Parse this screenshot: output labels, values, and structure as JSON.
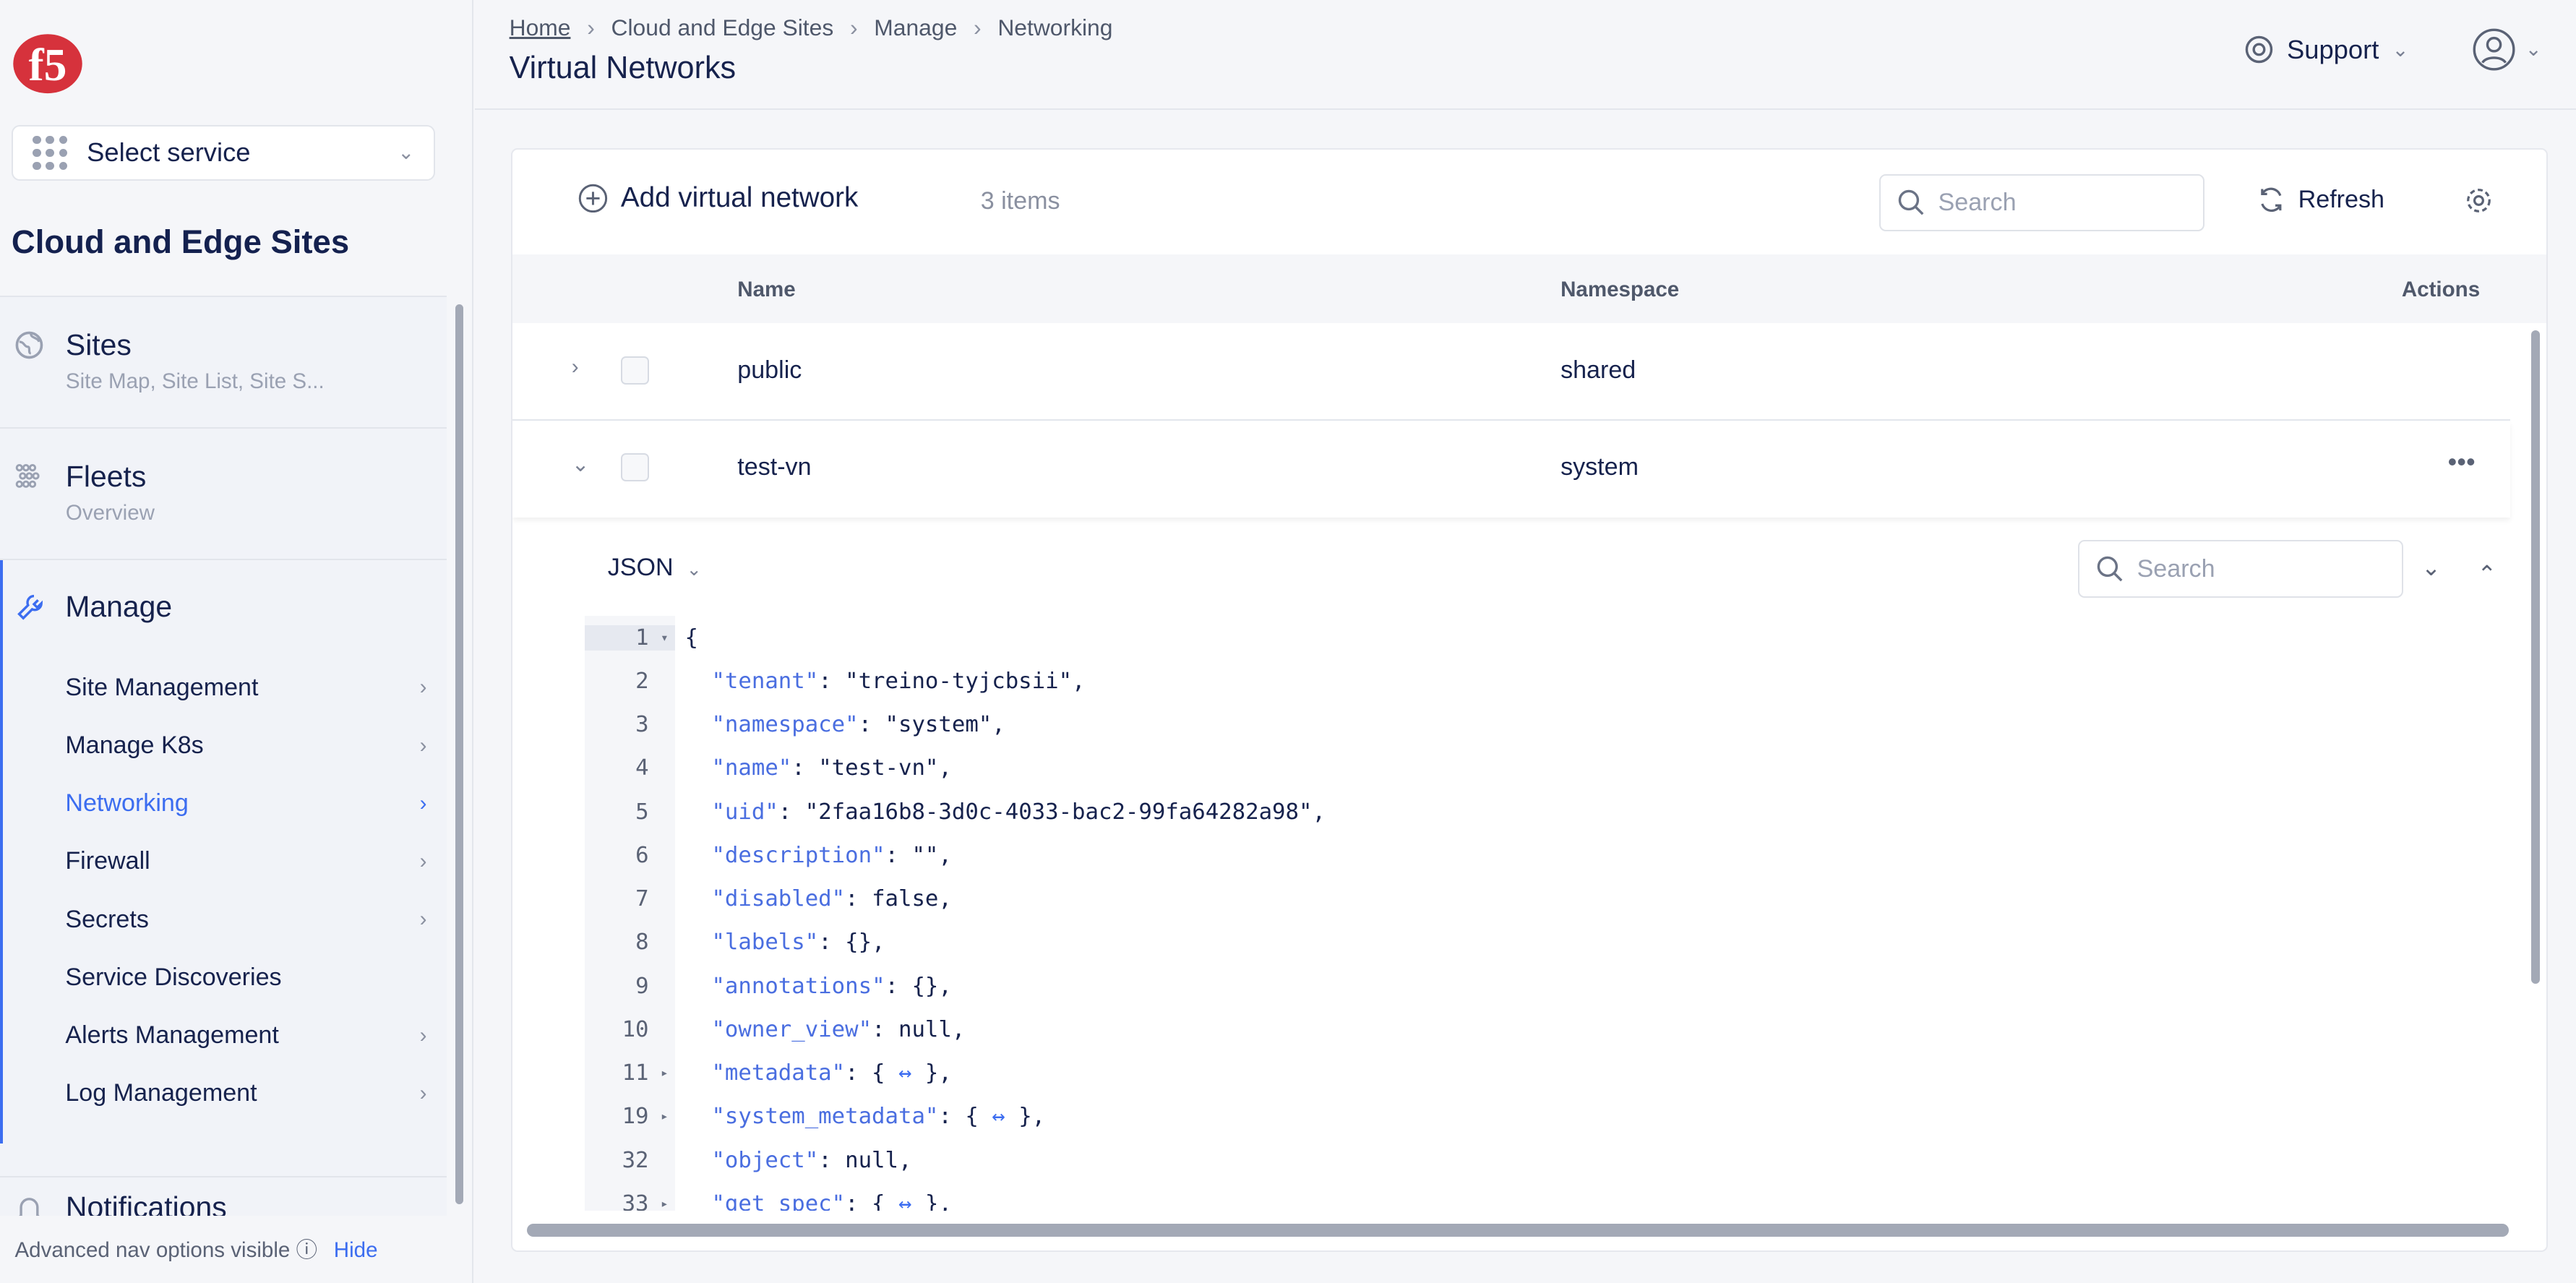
{
  "colors": {
    "accent": "#3c6df0",
    "brand": "#d6323c",
    "text": "#16224d"
  },
  "sidebar": {
    "select_service": "Select service",
    "service_title": "Cloud and Edge Sites",
    "sections": [
      {
        "label": "Sites",
        "sub": "Site Map, Site List, Site S...",
        "icon": "globe-icon"
      },
      {
        "label": "Fleets",
        "sub": "Overview",
        "icon": "fleet-icon"
      }
    ],
    "manage": {
      "label": "Manage",
      "icon": "wrench-icon",
      "items": [
        {
          "label": "Site Management",
          "chevron": true
        },
        {
          "label": "Manage K8s",
          "chevron": true
        },
        {
          "label": "Networking",
          "chevron": true,
          "active": true
        },
        {
          "label": "Firewall",
          "chevron": true
        },
        {
          "label": "Secrets",
          "chevron": true
        },
        {
          "label": "Service Discoveries",
          "chevron": false
        },
        {
          "label": "Alerts Management",
          "chevron": true
        },
        {
          "label": "Log Management",
          "chevron": true
        }
      ]
    },
    "notifications": "Notifications",
    "adv_nav": "Advanced nav options visible",
    "hide": "Hide"
  },
  "header": {
    "breadcrumb": [
      "Home",
      "Cloud and Edge Sites",
      "Manage",
      "Networking"
    ],
    "title": "Virtual Networks",
    "support": "Support"
  },
  "toolbar": {
    "add": "Add virtual network",
    "count": "3 items",
    "search_placeholder": "Search",
    "refresh": "Refresh"
  },
  "table": {
    "columns": [
      "Name",
      "Namespace",
      "Actions"
    ],
    "rows": [
      {
        "name": "public",
        "namespace": "shared",
        "expanded": false
      },
      {
        "name": "test-vn",
        "namespace": "system",
        "expanded": true
      }
    ]
  },
  "json_view": {
    "format": "JSON",
    "search_placeholder": "Search",
    "lines": [
      {
        "n": "1",
        "fold": "open",
        "code": "{"
      },
      {
        "n": "2",
        "key": "tenant",
        "val": "\"treino-tyjcbsii\","
      },
      {
        "n": "3",
        "key": "namespace",
        "val": "\"system\","
      },
      {
        "n": "4",
        "key": "name",
        "val": "\"test-vn\","
      },
      {
        "n": "5",
        "key": "uid",
        "val": "\"2faa16b8-3d0c-4033-bac2-99fa64282a98\","
      },
      {
        "n": "6",
        "key": "description",
        "val": "\"\","
      },
      {
        "n": "7",
        "key": "disabled",
        "val": "false,"
      },
      {
        "n": "8",
        "key": "labels",
        "val": "{},"
      },
      {
        "n": "9",
        "key": "annotations",
        "val": "{},"
      },
      {
        "n": "10",
        "key": "owner_view",
        "val": "null,"
      },
      {
        "n": "11",
        "fold": "closed",
        "key": "metadata",
        "collapsed": true
      },
      {
        "n": "19",
        "fold": "closed",
        "key": "system_metadata",
        "collapsed": true
      },
      {
        "n": "32",
        "key": "object",
        "val": "null,"
      },
      {
        "n": "33",
        "fold": "closed",
        "key": "get_spec",
        "collapsed": true
      }
    ]
  }
}
